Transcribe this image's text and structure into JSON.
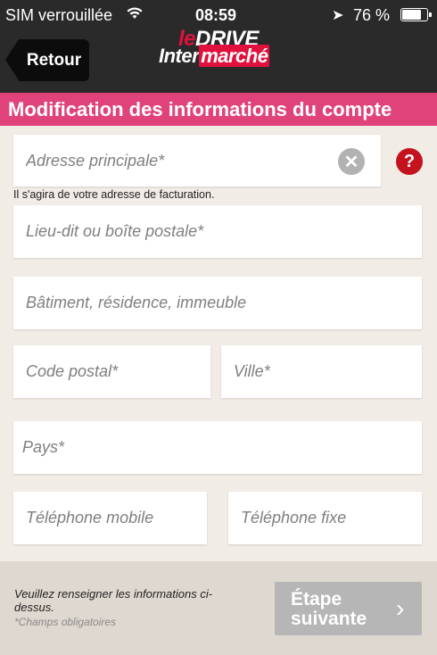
{
  "status_bar": {
    "carrier": "SIM verrouillée",
    "time": "08:59",
    "battery_percent": "76 %",
    "battery_level": 0.76
  },
  "header": {
    "back_label": "Retour",
    "logo_line1_a": "le",
    "logo_line1_b": "DRIVE",
    "logo_line2_a": "Inter",
    "logo_line2_b": "marché"
  },
  "page_title": "Modification des informations du compte",
  "form": {
    "address_placeholder": "Adresse principale*",
    "address_hint": "Il s'agira de votre adresse de facturation.",
    "lieu_dit_placeholder": "Lieu-dit ou boîte postale*",
    "batiment_placeholder": "Bâtiment, résidence, immeuble",
    "postal_code_placeholder": "Code postal*",
    "city_placeholder": "Ville*",
    "country_placeholder": "Pays*",
    "mobile_placeholder": "Téléphone mobile",
    "landline_placeholder": "Téléphone fixe"
  },
  "footer": {
    "message": "Veuillez renseigner les informations ci-dessus.",
    "required_note": "*Champs obligatoires",
    "next_label": "Étape suivante"
  },
  "colors": {
    "header_bg": "#2b2a2a",
    "title_band": "#e0437a",
    "help_icon": "#c4131e",
    "next_button_disabled": "#b6b6b6"
  }
}
